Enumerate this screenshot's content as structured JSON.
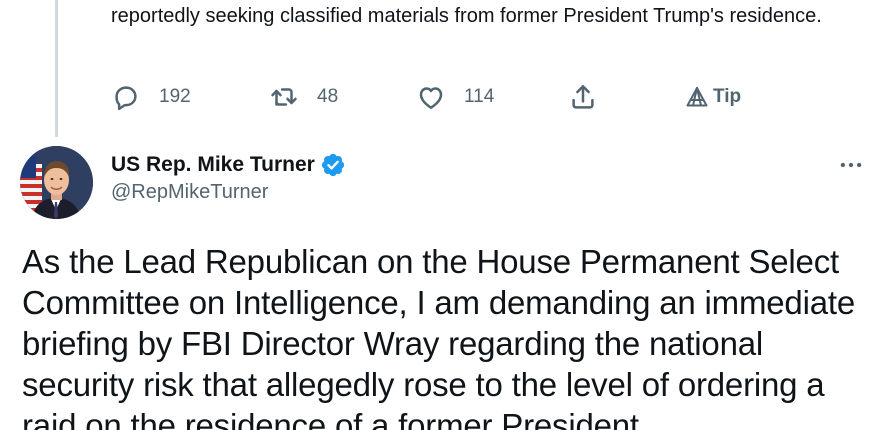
{
  "previous_tweet": {
    "text": "reportedly seeking classified materials from former President Trump's residence.",
    "actions": {
      "reply_count": "192",
      "retweet_count": "48",
      "like_count": "114",
      "tip_label": "Tip"
    }
  },
  "tweet": {
    "author_name": "US Rep. Mike Turner",
    "author_handle": "@RepMikeTurner",
    "verified": true,
    "text": "As the Lead Republican on the House Permanent Select Committee on Intelligence, I am demanding an immediate briefing by FBI Director Wray regarding the national security risk that allegedly rose to the level of ordering a raid on the residence of a former President"
  },
  "icons": {
    "reply": "reply-icon",
    "retweet": "retweet-icon",
    "like": "like-icon",
    "share": "share-icon",
    "tip": "tip-icon",
    "verified": "verified-badge-icon",
    "more": "more-options-icon"
  },
  "colors": {
    "text": "#0f1419",
    "secondary": "#536471",
    "verified_blue": "#1d9bf0",
    "thread_line": "#cfd9de"
  }
}
